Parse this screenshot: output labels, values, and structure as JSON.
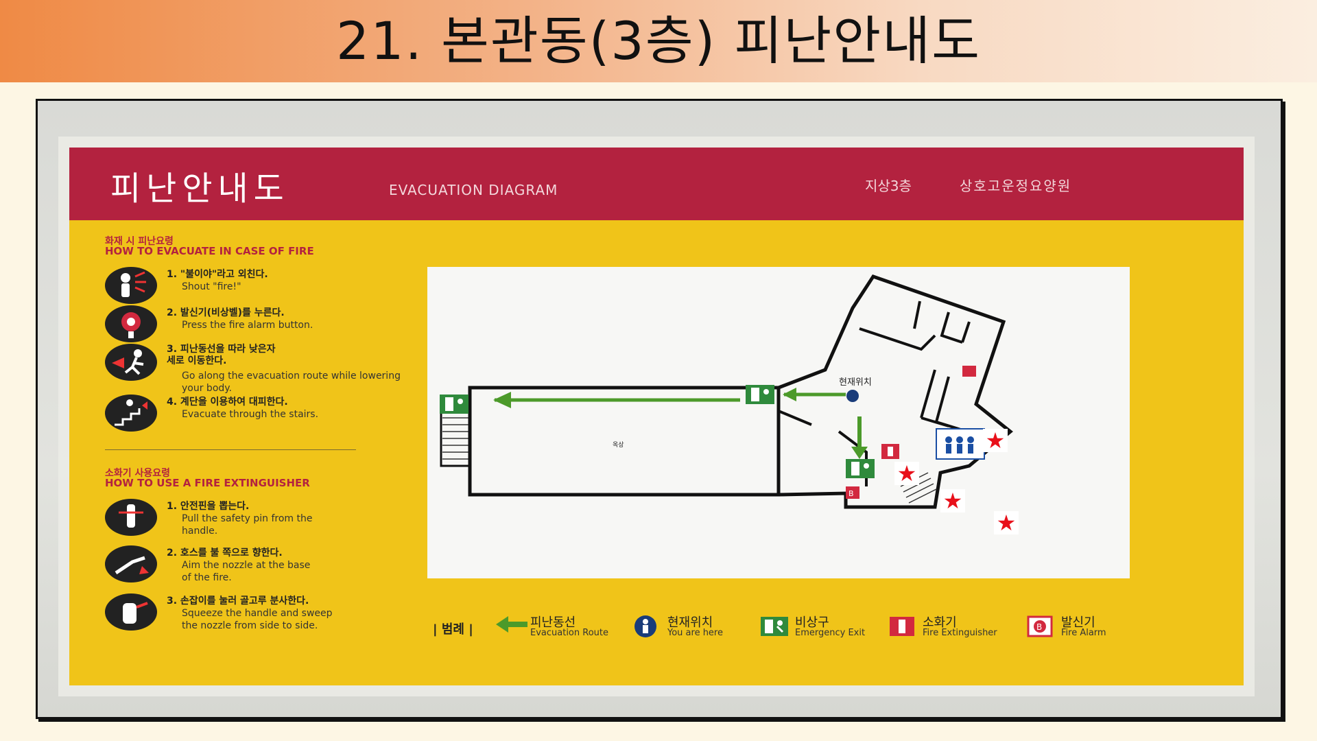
{
  "header": {
    "title": "21. 본관동(3층) 피난안내도"
  },
  "sign": {
    "title_ko": "피난안내도",
    "title_en": "EVACUATION DIAGRAM",
    "floor": "지상3층",
    "institution": "상호고운정요양원"
  },
  "evacuate": {
    "heading_ko": "화재 시 피난요령",
    "heading_en": "HOW TO EVACUATE IN CASE OF FIRE",
    "steps": [
      {
        "ko": "1. \"불이야\"라고 외친다.",
        "en": "Shout \"fire!\"",
        "icon": "shout-icon"
      },
      {
        "ko": "2. 발신기(비상벨)를 누른다.",
        "en": "Press the fire alarm button.",
        "icon": "alarm-button-icon"
      },
      {
        "ko": "3. 피난동선을 따라 낮은자세로 이동한다.",
        "en": "Go along the evacuation route while lowering your body.",
        "icon": "crouch-run-icon"
      },
      {
        "ko": "4. 계단을 이용하여 대피한다.",
        "en": "Evacuate through the stairs.",
        "icon": "stairs-icon"
      }
    ]
  },
  "extinguisher": {
    "heading_ko": "소화기 사용요령",
    "heading_en": "HOW TO USE A FIRE EXTINGUISHER",
    "steps": [
      {
        "ko": "1. 안전핀을 뽑는다.",
        "en": "Pull the safety pin from the handle.",
        "icon": "safety-pin-icon"
      },
      {
        "ko": "2. 호스를 불 쪽으로 향한다.",
        "en": "Aim the nozzle at the base of the fire.",
        "icon": "aim-nozzle-icon"
      },
      {
        "ko": "3. 손잡이를 눌러 골고루 분사한다.",
        "en": "Squeeze the handle and sweep the nozzle from side to side.",
        "icon": "squeeze-handle-icon"
      }
    ]
  },
  "plan": {
    "rooms": {
      "rooftop": "옥상",
      "you_are_here": "현재위치"
    }
  },
  "legend": {
    "label": "| 범례 |",
    "items": [
      {
        "ko": "피난동선",
        "en": "Evacuation Route",
        "icon": "evacuation-arrow-icon"
      },
      {
        "ko": "현재위치",
        "en": "You are here",
        "icon": "you-are-here-icon"
      },
      {
        "ko": "비상구",
        "en": "Emergency Exit",
        "icon": "emergency-exit-icon"
      },
      {
        "ko": "소화기",
        "en": "Fire Extinguisher",
        "icon": "fire-extinguisher-icon"
      },
      {
        "ko": "발신기",
        "en": "Fire Alarm",
        "icon": "fire-alarm-icon"
      }
    ]
  },
  "colors": {
    "banner_red": "#b3223f",
    "sign_yellow": "#f0c419",
    "route_green": "#4c9a2a",
    "marker_star": "#e8101a"
  }
}
